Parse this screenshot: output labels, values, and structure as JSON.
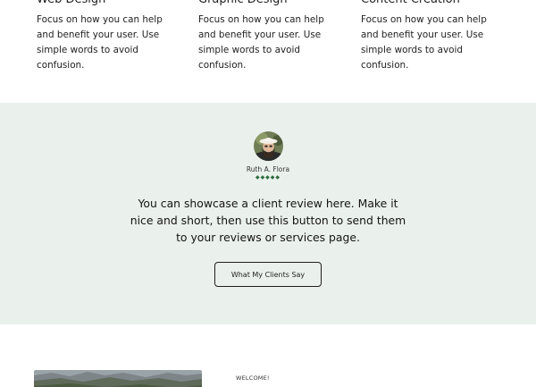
{
  "services": [
    {
      "title": "Web Design",
      "description": "Focus on how you can help and benefit your user. Use simple words to avoid confusion."
    },
    {
      "title": "Graphic Design",
      "description": "Focus on how you can help and benefit your user. Use simple words to avoid confusion."
    },
    {
      "title": "Content Creation",
      "description": "Focus on how you can help and benefit your user. Use simple words to avoid confusion."
    }
  ],
  "testimonial": {
    "reviewer_name": "Ruth A. Flora",
    "rating_stars": 5,
    "stars_text": "◆◆◆◆◆",
    "quote": "You can showcase a client review here. Make it nice and short, then use this button to send them to your reviews or services page.",
    "cta_label": "What My Clients Say",
    "background_color": "#eaf1ec",
    "star_color": "#2e6b3e"
  },
  "about": {
    "eyebrow": "WELCOME!"
  }
}
